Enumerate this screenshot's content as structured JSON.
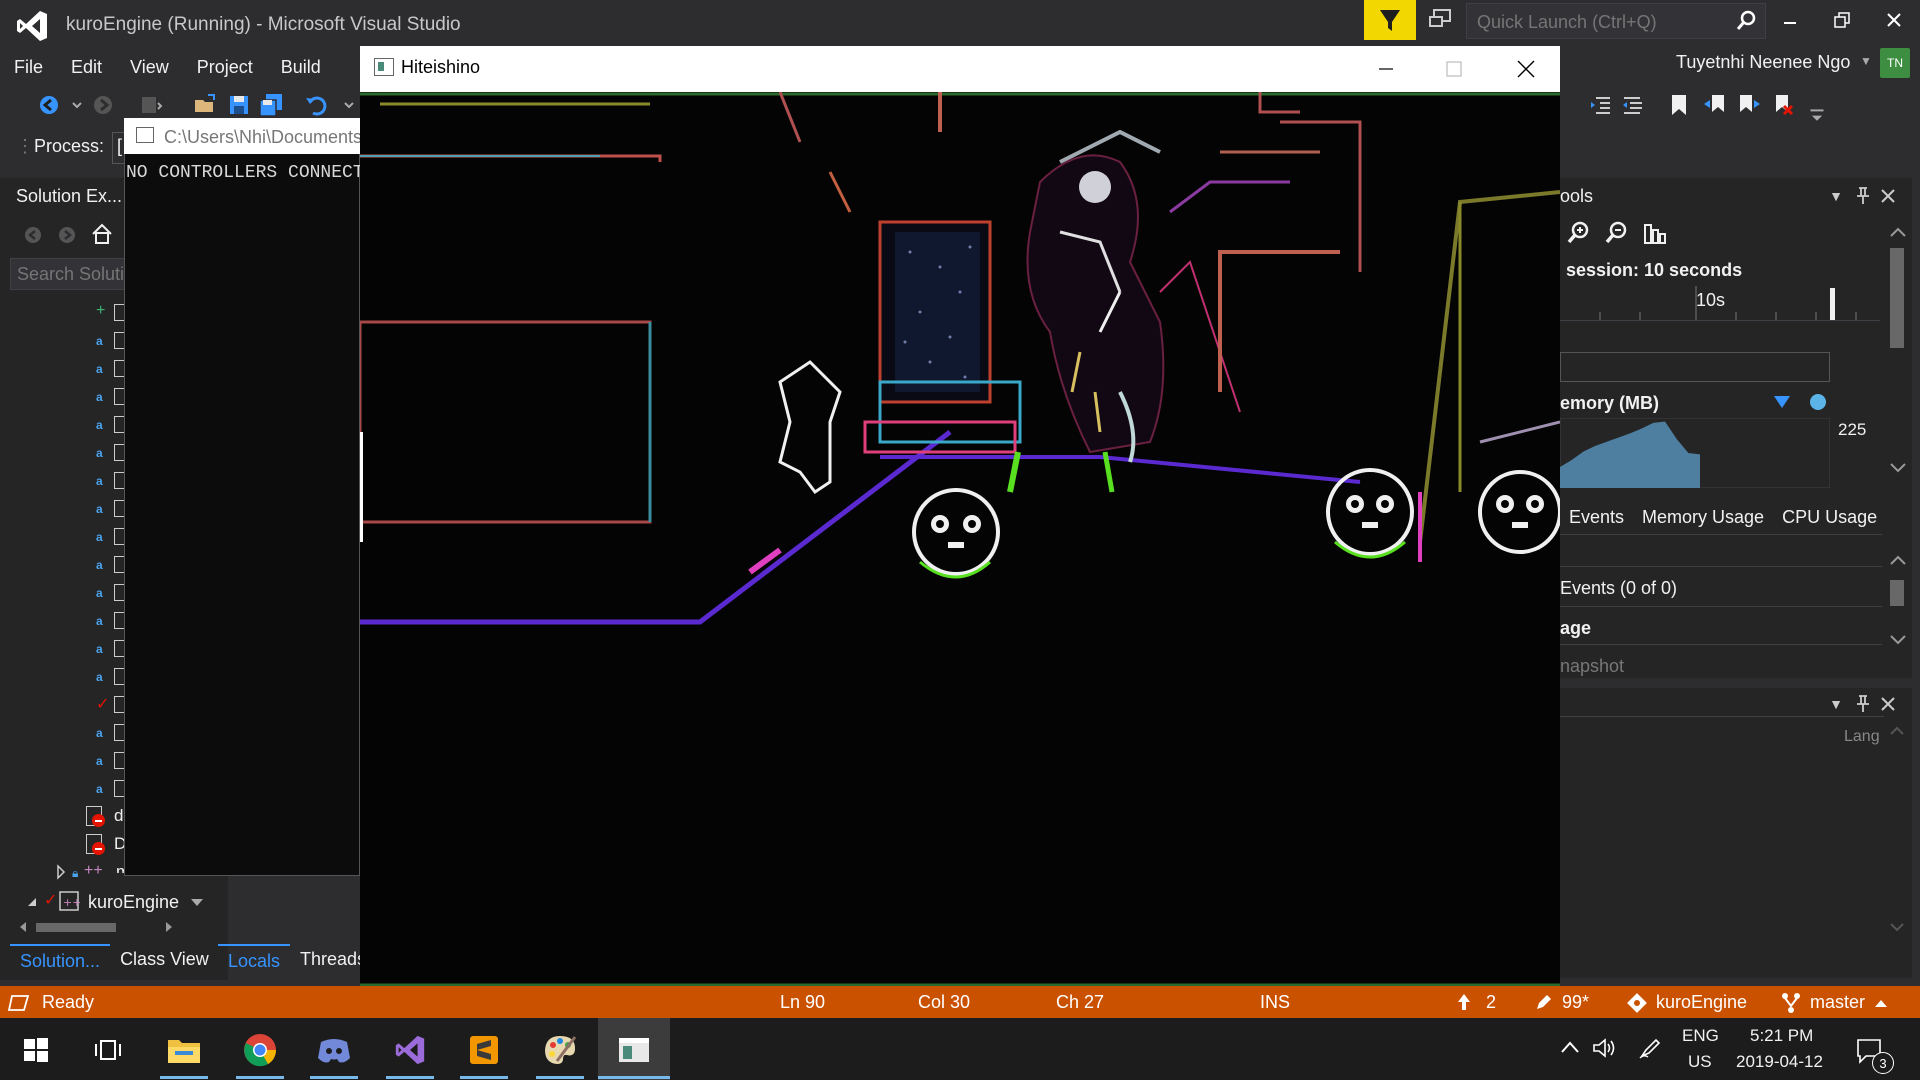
{
  "app": {
    "title": "kuroEngine (Running) - Microsoft Visual Studio",
    "quick_launch_placeholder": "Quick Launch (Ctrl+Q)",
    "user_name": "Tuyetnhi Neenee Ngo",
    "user_initials": "TN"
  },
  "menu": [
    "File",
    "Edit",
    "View",
    "Project",
    "Build"
  ],
  "toolbar": {
    "process_label": "Process:",
    "process_value": "["
  },
  "solution_explorer": {
    "title": "Solution Ex...",
    "search_placeholder": "Search Solutio",
    "files": [
      {
        "status": "add"
      },
      {
        "status": "lock"
      },
      {
        "status": "lock"
      },
      {
        "status": "lock"
      },
      {
        "status": "lock"
      },
      {
        "status": "lock"
      },
      {
        "status": "lock"
      },
      {
        "status": "lock"
      },
      {
        "status": "lock"
      },
      {
        "status": "lock"
      },
      {
        "status": "lock"
      },
      {
        "status": "lock"
      },
      {
        "status": "lock"
      },
      {
        "status": "lock"
      },
      {
        "status": "check"
      },
      {
        "status": "lock"
      },
      {
        "status": "lock"
      },
      {
        "status": "lock"
      }
    ],
    "error_file_1": "d",
    "error_file_2": "D",
    "main_cpp": "main.cpp",
    "project": "kuroEngine",
    "tabs": [
      "Solution...",
      "Class View"
    ]
  },
  "debug_tabs": [
    "Locals",
    "Threads"
  ],
  "console": {
    "title": "C:\\Users\\Nhi\\Documents",
    "text": "NO CONTROLLERS CONNECT"
  },
  "game_window": {
    "title": "Hiteishino"
  },
  "diagnostics": {
    "title": "ools",
    "session": "session: 10 seconds",
    "tick": "10s",
    "memory_label": "emory (MB)",
    "memory_max": "225",
    "tabs": [
      "Events",
      "Memory Usage",
      "CPU Usage"
    ],
    "events_count": "Events (0 of 0)",
    "usage_label": "age",
    "snapshot": "napshot",
    "memory_series": [
      0.3,
      0.4,
      0.52,
      0.6,
      0.66,
      0.72,
      0.78,
      0.85,
      0.93,
      0.95,
      0.7,
      0.5,
      0.48
    ]
  },
  "lower_panel": {
    "lang": "Lang"
  },
  "statusbar": {
    "ready": "Ready",
    "ln": "Ln 90",
    "col": "Col 30",
    "ch": "Ch 27",
    "ins": "INS",
    "push_count": "2",
    "changes": "99*",
    "repo": "kuroEngine",
    "branch": "master"
  },
  "taskbar": {
    "apps": [
      "windows-start",
      "task-view",
      "file-explorer",
      "chrome",
      "discord",
      "visual-studio",
      "sublime-text",
      "paint",
      "game-app"
    ],
    "lang1": "ENG",
    "lang2": "US",
    "time": "5:21 PM",
    "date": "2019-04-12",
    "notifications": "3"
  },
  "colors": {
    "vs_bg": "#2d2d30",
    "status_orange": "#ca5100",
    "accent_blue": "#3794ff",
    "filter_yellow": "#f2d700"
  }
}
